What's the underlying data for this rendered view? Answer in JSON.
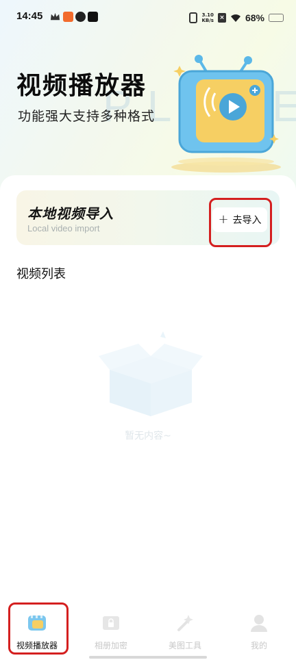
{
  "status_bar": {
    "time": "14:45",
    "net_speed_value": "3.10",
    "net_speed_unit": "KB/s",
    "battery_percent": "68%",
    "battery_level": 0.68
  },
  "header": {
    "title": "视频播放器",
    "subtitle": "功能强大支持多种格式",
    "watermark": "PLAYER"
  },
  "import_card": {
    "title": "本地视频导入",
    "subtitle": "Local video import",
    "button_label": "去导入"
  },
  "video_list": {
    "title": "视频列表",
    "empty_text": "暂无内容~"
  },
  "bottom_nav": {
    "items": [
      {
        "label": "视频播放器",
        "icon": "video-player-icon",
        "active": true
      },
      {
        "label": "相册加密",
        "icon": "album-lock-icon",
        "active": false
      },
      {
        "label": "美图工具",
        "icon": "beauty-tool-icon",
        "active": false
      },
      {
        "label": "我的",
        "icon": "profile-icon",
        "active": false
      }
    ]
  },
  "colors": {
    "accent_red": "#d41f1f",
    "battery_yellow": "#f2b705",
    "tv_blue": "#5bb8e8",
    "tv_yellow": "#f6cf63"
  }
}
